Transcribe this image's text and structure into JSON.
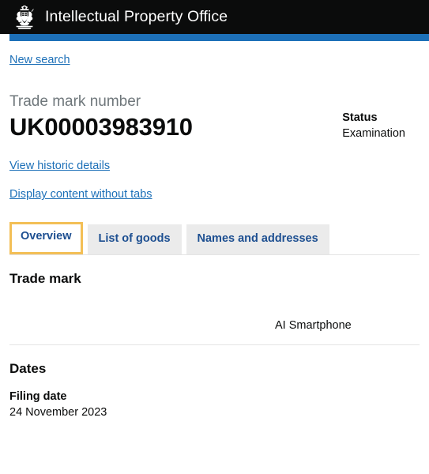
{
  "header": {
    "crest_icon": "royal-coat-of-arms-icon",
    "title": "Intellectual Property Office",
    "bar_color": "#1d70b8",
    "background_color": "#0b0c0c"
  },
  "nav": {
    "new_search": "New search"
  },
  "trade_mark": {
    "number_label": "Trade mark number",
    "number_value": "UK00003983910"
  },
  "status": {
    "label": "Status",
    "value": "Examination"
  },
  "links": {
    "view_historic_details": "View historic details",
    "display_without_tabs": "Display content without tabs"
  },
  "tabs": {
    "active_index": 0,
    "focus_color": "#f3bf56",
    "items": [
      {
        "label": "Overview",
        "active": true
      },
      {
        "label": "List of goods",
        "active": false
      },
      {
        "label": "Names and addresses",
        "active": false
      }
    ]
  },
  "sections": {
    "trade_mark": {
      "heading": "Trade mark",
      "mark_text": "AI Smartphone"
    },
    "dates": {
      "heading": "Dates",
      "filing_date_label": "Filing date",
      "filing_date_value": "24 November 2023"
    }
  }
}
